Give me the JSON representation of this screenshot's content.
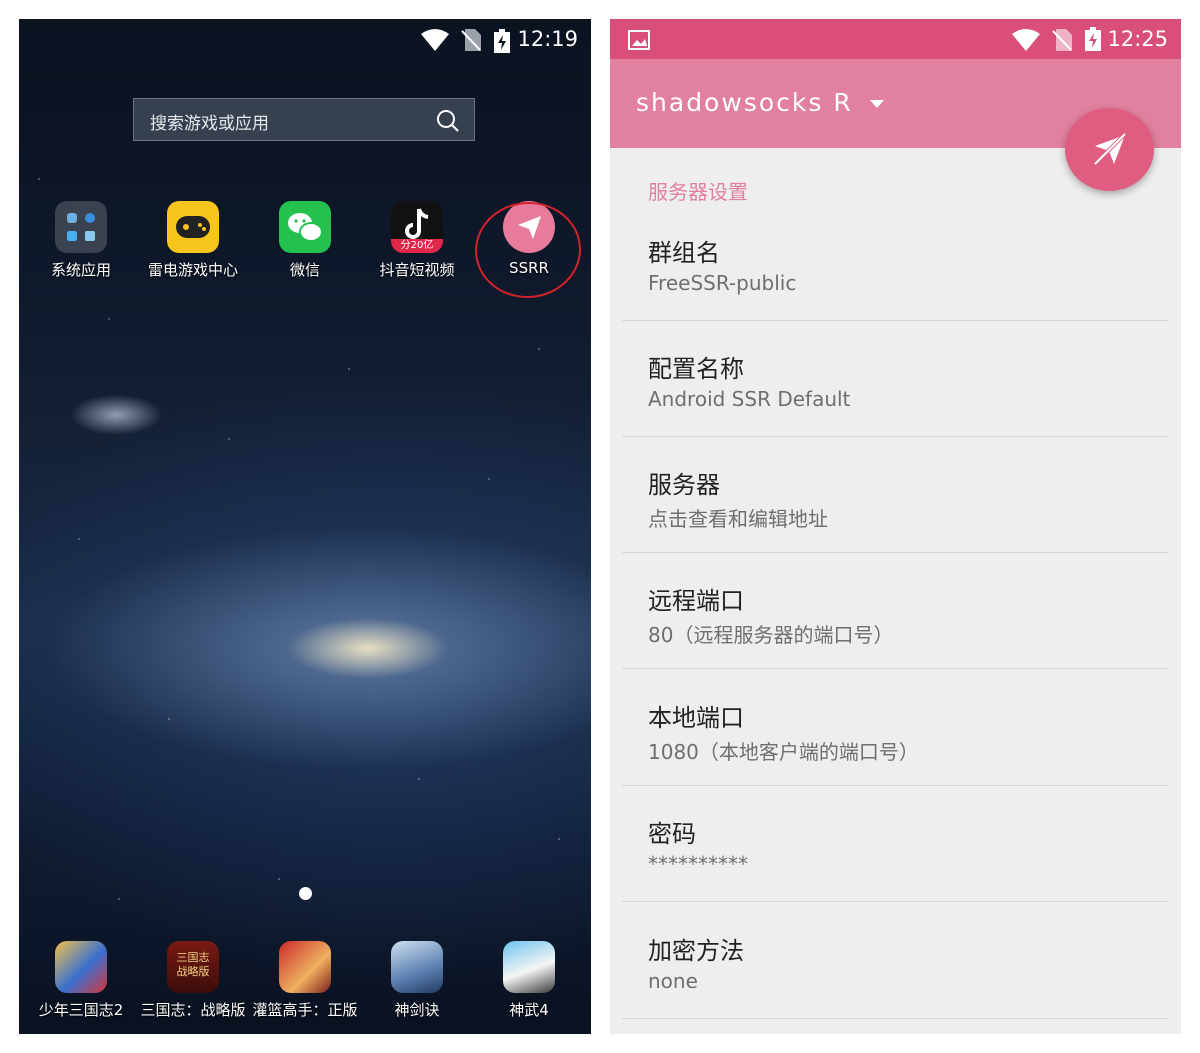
{
  "left": {
    "status_time": "12:19",
    "search_placeholder": "搜索游戏或应用",
    "apps": [
      {
        "label": "系统应用",
        "icon": "system-apps-folder"
      },
      {
        "label": "雷电游戏中心",
        "icon": "gamepad-icon"
      },
      {
        "label": "微信",
        "icon": "wechat-icon"
      },
      {
        "label": "抖音短视频",
        "icon": "tiktok-icon",
        "badge": "分20亿"
      },
      {
        "label": "SSRR",
        "icon": "paper-plane-icon"
      }
    ],
    "dock": [
      {
        "label": "少年三国志2"
      },
      {
        "label": "三国志：战略版"
      },
      {
        "label": "灌篮高手：正版"
      },
      {
        "label": "神剑诀"
      },
      {
        "label": "神武4"
      }
    ],
    "ssrr_icon_mark": "三国志 战略版"
  },
  "right": {
    "status_time": "12:25",
    "app_title": "shadowsocks R",
    "section_header": "服务器设置",
    "prefs": [
      {
        "title": "群组名",
        "summary": "FreeSSR-public"
      },
      {
        "title": "配置名称",
        "summary": "Android SSR Default"
      },
      {
        "title": "服务器",
        "summary": "点击查看和编辑地址"
      },
      {
        "title": "远程端口",
        "summary": "80（远程服务器的端口号）"
      },
      {
        "title": "本地端口",
        "summary": "1080（本地客户端的端口号）"
      },
      {
        "title": "密码",
        "summary": "**********"
      },
      {
        "title": "加密方法",
        "summary": "none"
      }
    ]
  },
  "colors": {
    "accent_pink": "#e2809f",
    "status_pink": "#d94f7a",
    "fab_pink": "#df5d80",
    "annotation_red": "#d2222a"
  }
}
